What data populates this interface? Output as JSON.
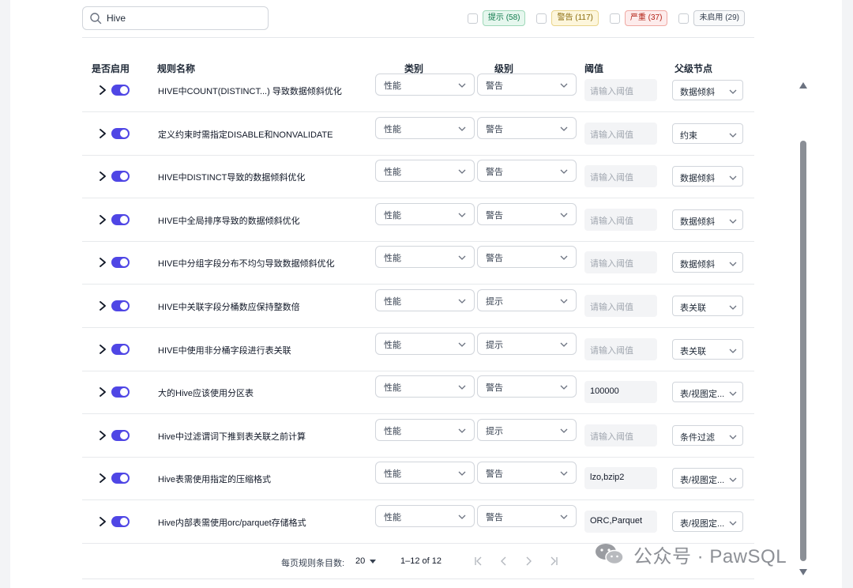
{
  "search": {
    "value": "Hive",
    "placeholder": ""
  },
  "filters": [
    {
      "label": "提示 (58)",
      "kind": "tip"
    },
    {
      "label": "警告 (117)",
      "kind": "warn"
    },
    {
      "label": "严重 (37)",
      "kind": "crit"
    },
    {
      "label": "未启用 (29)",
      "kind": "off"
    }
  ],
  "columns": {
    "enabled": "是否启用",
    "name": "规则名称",
    "category": "类别",
    "level": "级别",
    "threshold": "阈值",
    "parent": "父级节点"
  },
  "threshold_placeholder": "请输入阈值",
  "rules": [
    {
      "name": "HIVE中COUNT(DISTINCT...) 导致数据倾斜优化",
      "category": "性能",
      "level": "警告",
      "threshold": "",
      "parent": "数据倾斜"
    },
    {
      "name": "定义约束时需指定DISABLE和NONVALIDATE",
      "category": "性能",
      "level": "警告",
      "threshold": "",
      "parent": "约束"
    },
    {
      "name": "HIVE中DISTINCT导致的数据倾斜优化",
      "category": "性能",
      "level": "警告",
      "threshold": "",
      "parent": "数据倾斜"
    },
    {
      "name": "HIVE中全局排序导致的数据倾斜优化",
      "category": "性能",
      "level": "警告",
      "threshold": "",
      "parent": "数据倾斜"
    },
    {
      "name": "HIVE中分组字段分布不均匀导致数据倾斜优化",
      "category": "性能",
      "level": "警告",
      "threshold": "",
      "parent": "数据倾斜"
    },
    {
      "name": "HIVE中关联字段分桶数应保持整数倍",
      "category": "性能",
      "level": "提示",
      "threshold": "",
      "parent": "表关联"
    },
    {
      "name": "HIVE中使用非分桶字段进行表关联",
      "category": "性能",
      "level": "提示",
      "threshold": "",
      "parent": "表关联"
    },
    {
      "name": "大的Hive应该使用分区表",
      "category": "性能",
      "level": "警告",
      "threshold": "100000",
      "parent": "表/视图定..."
    },
    {
      "name": "Hive中过滤谓词下推到表关联之前计算",
      "category": "性能",
      "level": "提示",
      "threshold": "",
      "parent": "条件过滤"
    },
    {
      "name": "Hive表需使用指定的压缩格式",
      "category": "性能",
      "level": "警告",
      "threshold": "lzo,bzip2",
      "parent": "表/视图定..."
    },
    {
      "name": "Hive内部表需使用orc/parquet存储格式",
      "category": "性能",
      "level": "警告",
      "threshold": "ORC,Parquet",
      "parent": "表/视图定..."
    }
  ],
  "pagination": {
    "rows_label": "每页规则条目数:",
    "page_size": "20",
    "range": "1–12 of 12"
  },
  "watermark": "公众号 · PawSQL",
  "colors": {
    "accent": "#4f46e5",
    "tip": "#0f7a4c",
    "warn": "#8a6b0a",
    "crit": "#b42318"
  },
  "icons": [
    "search-icon",
    "chevron-right-icon",
    "chevron-down-icon",
    "first-page-icon",
    "prev-page-icon",
    "next-page-icon",
    "last-page-icon",
    "wechat-icon"
  ]
}
